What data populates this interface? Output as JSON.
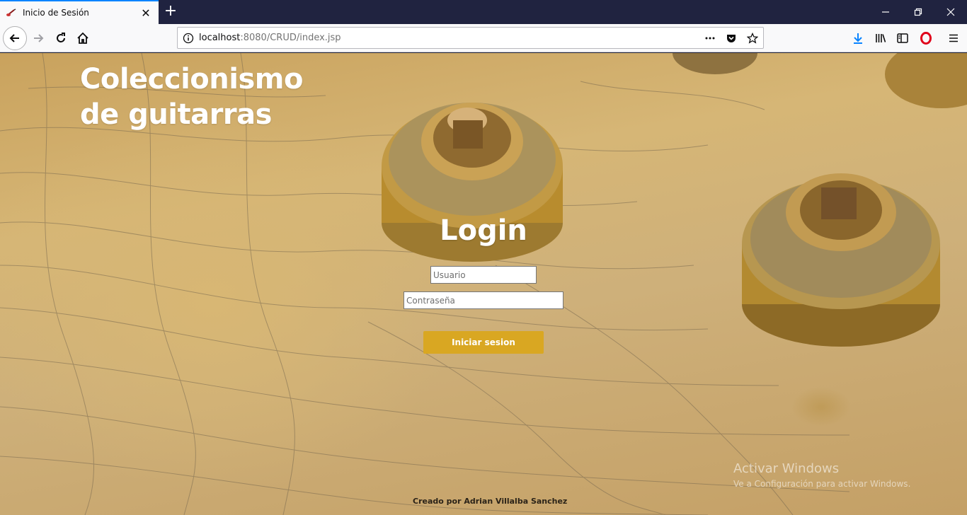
{
  "browser": {
    "tab": {
      "title": "Inicio de Sesión",
      "favicon": "guitar-favicon-icon"
    },
    "url": {
      "host": "localhost",
      "rest": ":8080/CRUD/index.jsp"
    },
    "colors": {
      "tab_accent": "#0a84ff",
      "tabbar_bg": "#202340",
      "download_icon": "#0a84ff",
      "opera_icon": "#e0001b"
    }
  },
  "page": {
    "site_title": "Coleccionismo de guitarras",
    "login_heading": "Login",
    "form": {
      "username_placeholder": "Usuario",
      "password_placeholder": "Contraseña",
      "submit_label": "Iniciar sesion"
    },
    "footer": "Creado por Adrian Villalba Sanchez",
    "colors": {
      "button": "#d9a722",
      "text": "#ffffff"
    },
    "background": "guitar-knobs-photo"
  },
  "watermark": {
    "title": "Activar Windows",
    "subtitle": "Ve a Configuración para activar Windows."
  }
}
